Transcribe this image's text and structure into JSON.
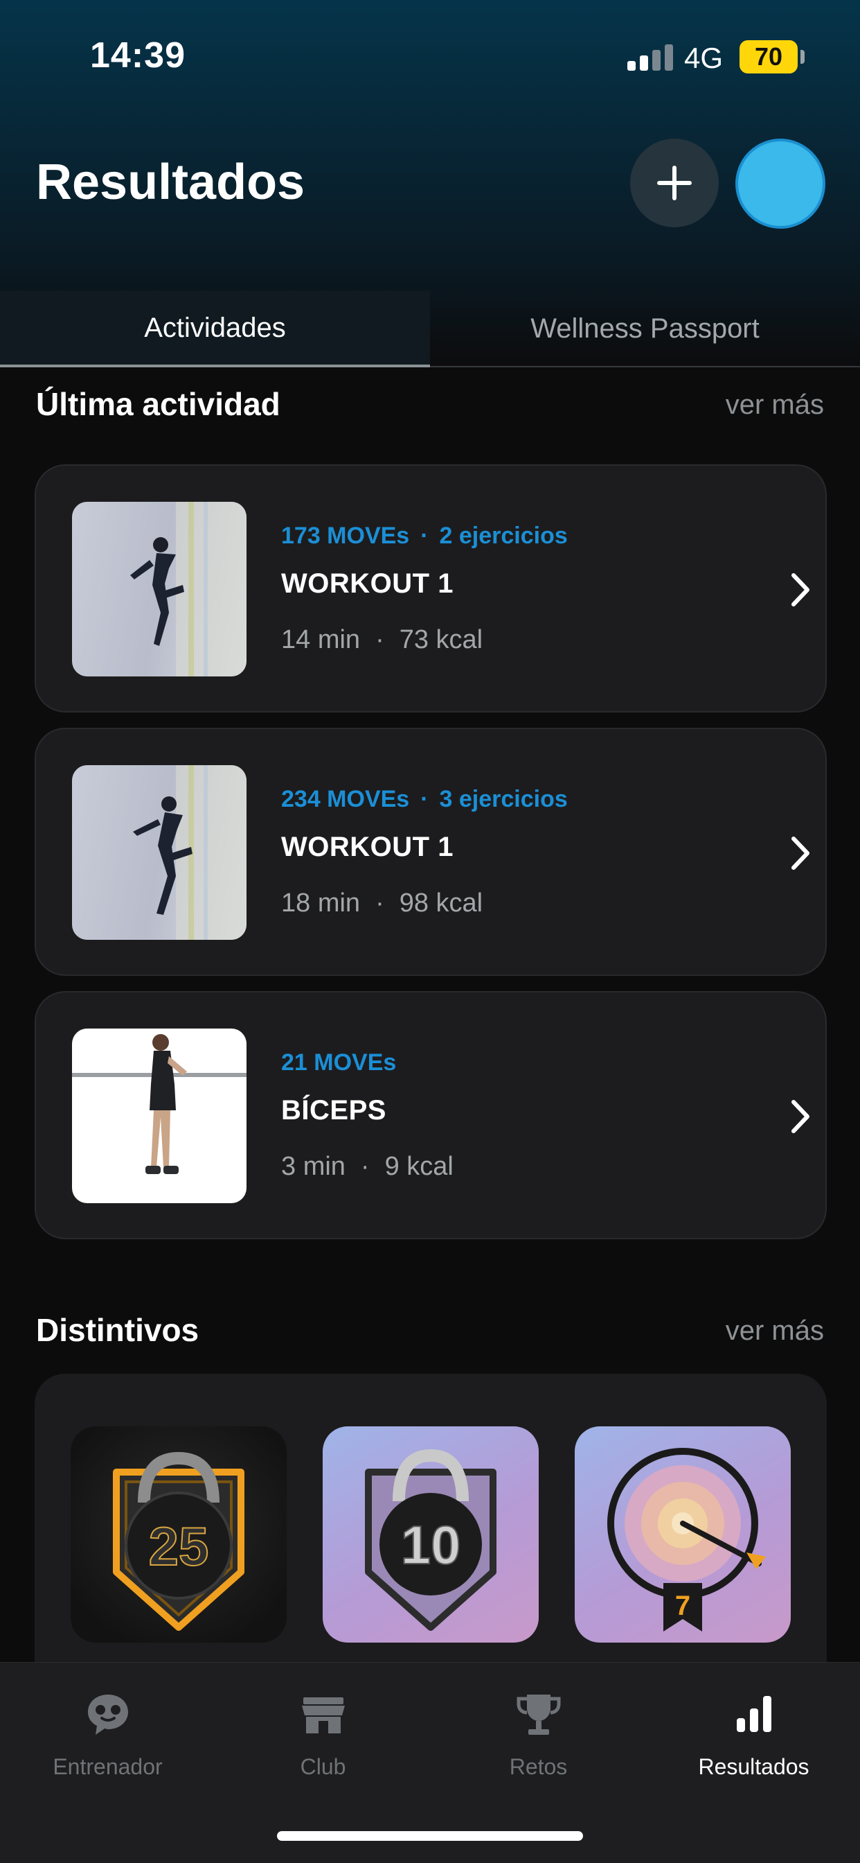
{
  "status_bar": {
    "time": "14:39",
    "network": "4G",
    "battery": "70"
  },
  "header": {
    "title": "Resultados"
  },
  "tabs": [
    {
      "label": "Actividades",
      "active": true
    },
    {
      "label": "Wellness Passport",
      "active": false
    }
  ],
  "last_activity": {
    "title": "Última actividad",
    "more": "ver más",
    "items": [
      {
        "moves": "173 MOVEs",
        "exercises": "2 ejercicios",
        "name": "WORKOUT 1",
        "duration": "14 min",
        "kcal": "73 kcal"
      },
      {
        "moves": "234 MOVEs",
        "exercises": "3 ejercicios",
        "name": "WORKOUT 1",
        "duration": "18 min",
        "kcal": "98 kcal"
      },
      {
        "moves": "21 MOVEs",
        "exercises": "",
        "name": "BÍCEPS",
        "duration": "3 min",
        "kcal": "9 kcal"
      }
    ]
  },
  "badges": {
    "title": "Distintivos",
    "more": "ver más",
    "items": [
      {
        "icon": "kettlebell-gold-badge-icon",
        "number": "25"
      },
      {
        "icon": "kettlebell-silver-badge-icon",
        "number": "10"
      },
      {
        "icon": "target-arrow-badge-icon",
        "number": "7"
      }
    ]
  },
  "bottom_nav": [
    {
      "label": "Entrenador",
      "icon": "coach-chat-icon",
      "active": false
    },
    {
      "label": "Club",
      "icon": "store-icon",
      "active": false
    },
    {
      "label": "Retos",
      "icon": "trophy-icon",
      "active": false
    },
    {
      "label": "Resultados",
      "icon": "bar-chart-icon",
      "active": true
    }
  ],
  "colors": {
    "accent_blue": "#1b8fd6",
    "avatar": "#3ab9ea",
    "battery": "#ffd60a"
  }
}
